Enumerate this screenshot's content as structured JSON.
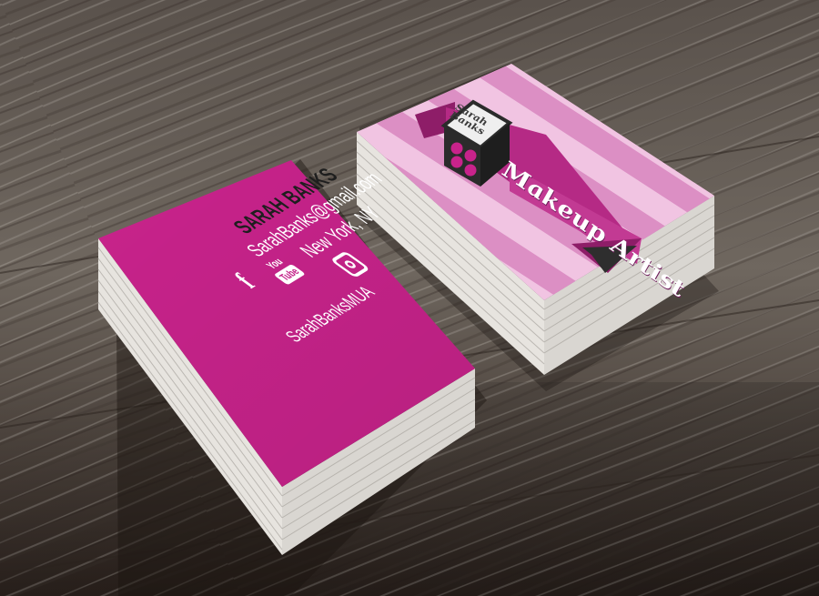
{
  "scene": {
    "description_free": true,
    "colors": {
      "wood_dark": "#2f2722",
      "wood_mid": "#6d655e",
      "wood_light": "#a7a19b",
      "card_pink": "#c8238b",
      "stripe_light": "#f2c6e3",
      "stripe_mid": "#d98ac1",
      "ribbon": "#b0297f",
      "cube": "#2b2b2b",
      "paper_edge": "#e9e7e3"
    }
  },
  "front_card": {
    "name": "SARAH BANKS",
    "email": "SarahBanks@gmail.com",
    "city": "New York, NY",
    "facebook_glyph": "f",
    "youtube_you": "You",
    "youtube_tube": "Tube",
    "handle": "SarahBanksMUA",
    "icons": [
      "facebook-icon",
      "youtube-icon",
      "instagram-icon"
    ]
  },
  "back_card": {
    "cube_name_line1": "Sarah",
    "cube_name_line2": "Banks",
    "ribbon_text": "Makeup Artist"
  }
}
